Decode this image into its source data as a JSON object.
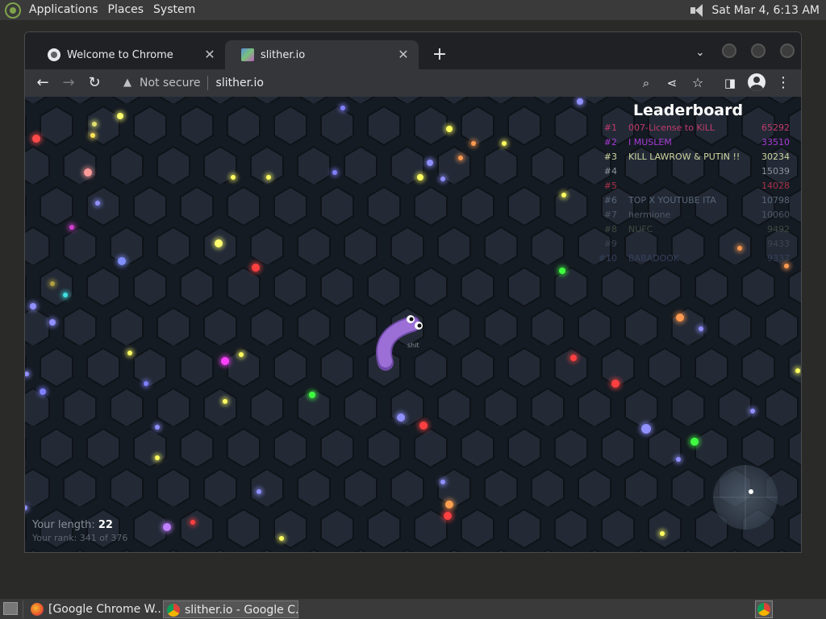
{
  "top_panel": {
    "menus": [
      "Applications",
      "Places",
      "System"
    ],
    "clock": "Sat Mar  4,  6:13 AM"
  },
  "browser": {
    "tabs": [
      {
        "title": "Welcome to Chrome",
        "icon": "chrome-globe-icon",
        "active": false
      },
      {
        "title": "slither.io",
        "icon": "slither-favicon",
        "active": true
      }
    ],
    "security_label": "Not secure",
    "url": "slither.io"
  },
  "game": {
    "leaderboard_title": "Leaderboard",
    "leaderboard": [
      {
        "rank": "#1",
        "name": "007-License to KiLL",
        "score": "65292",
        "color": "#c23b6b"
      },
      {
        "rank": "#2",
        "name": "I MUSLEM",
        "score": "33510",
        "color": "#a63ad6"
      },
      {
        "rank": "#3",
        "name": "KILL LAWROW & PUTIN !!",
        "score": "30234",
        "color": "#cfd6a0"
      },
      {
        "rank": "#4",
        "name": "",
        "score": "15039",
        "color": "#8d949c"
      },
      {
        "rank": "#5",
        "name": "",
        "score": "14028",
        "color": "#a8324a"
      },
      {
        "rank": "#6",
        "name": "TOP X YOUTUBE ITA",
        "score": "10798",
        "color": "#5a6677"
      },
      {
        "rank": "#7",
        "name": "hermione",
        "score": "10060",
        "color": "#4e5764"
      },
      {
        "rank": "#8",
        "name": "NUFC",
        "score": "9492",
        "color": "#3f4a40"
      },
      {
        "rank": "#9",
        "name": "",
        "score": "9433",
        "color": "#3c4450"
      },
      {
        "rank": "#10",
        "name": "BABADOOK",
        "score": "9337",
        "color": "#353f5a"
      }
    ],
    "length_label": "Your length:",
    "length_value": "22",
    "rank_text": "Your rank: 341 of 376",
    "player_name": "shit",
    "snake_color": "#9b6fd6"
  },
  "taskbar": {
    "items": [
      {
        "label": "[Google Chrome W...",
        "icon": "firefox-icon",
        "active": false
      },
      {
        "label": "slither.io - Google C...",
        "icon": "chrome-icon",
        "active": true
      }
    ]
  }
}
